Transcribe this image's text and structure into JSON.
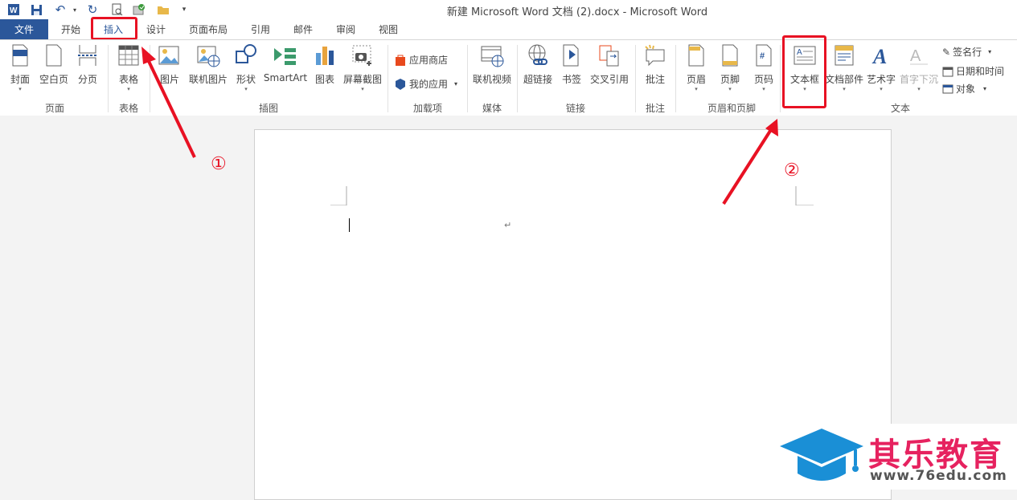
{
  "window": {
    "title": "新建 Microsoft Word 文档 (2).docx - Microsoft Word"
  },
  "tabs": {
    "file": "文件",
    "home": "开始",
    "insert": "插入",
    "design": "设计",
    "layout": "页面布局",
    "references": "引用",
    "mailings": "邮件",
    "review": "审阅",
    "view": "视图"
  },
  "ribbon": {
    "pages": {
      "cover": "封面",
      "blank": "空白页",
      "break": "分页",
      "group": "页面"
    },
    "tables": {
      "table": "表格",
      "group": "表格"
    },
    "illustrations": {
      "pictures": "图片",
      "online_pictures": "联机图片",
      "shapes": "形状",
      "smartart": "SmartArt",
      "chart": "图表",
      "screenshot": "屏幕截图",
      "group": "插图"
    },
    "addins": {
      "store": "应用商店",
      "my_apps": "我的应用",
      "group": "加载项"
    },
    "media": {
      "online_video": "联机视频",
      "group": "媒体"
    },
    "links": {
      "hyperlink": "超链接",
      "bookmark": "书签",
      "cross_ref": "交叉引用",
      "group": "链接"
    },
    "comments": {
      "comment": "批注",
      "group": "批注"
    },
    "header_footer": {
      "header": "页眉",
      "footer": "页脚",
      "page_number": "页码",
      "group": "页眉和页脚"
    },
    "text": {
      "textbox": "文本框",
      "quick_parts": "文档部件",
      "wordart": "艺术字",
      "dropcap": "首字下沉",
      "signature": "签名行",
      "datetime": "日期和时间",
      "object": "对象",
      "group": "文本"
    }
  },
  "document": {
    "paragraph_mark": "↵"
  },
  "annotations": {
    "step1": "①",
    "step2": "②"
  },
  "watermark": {
    "name": "其乐教育",
    "url": "www.76edu.com"
  },
  "colors": {
    "file_tab": "#2b579a",
    "highlight": "#e81123",
    "logo_blue": "#1a8fd6",
    "logo_pink": "#e6225f"
  }
}
